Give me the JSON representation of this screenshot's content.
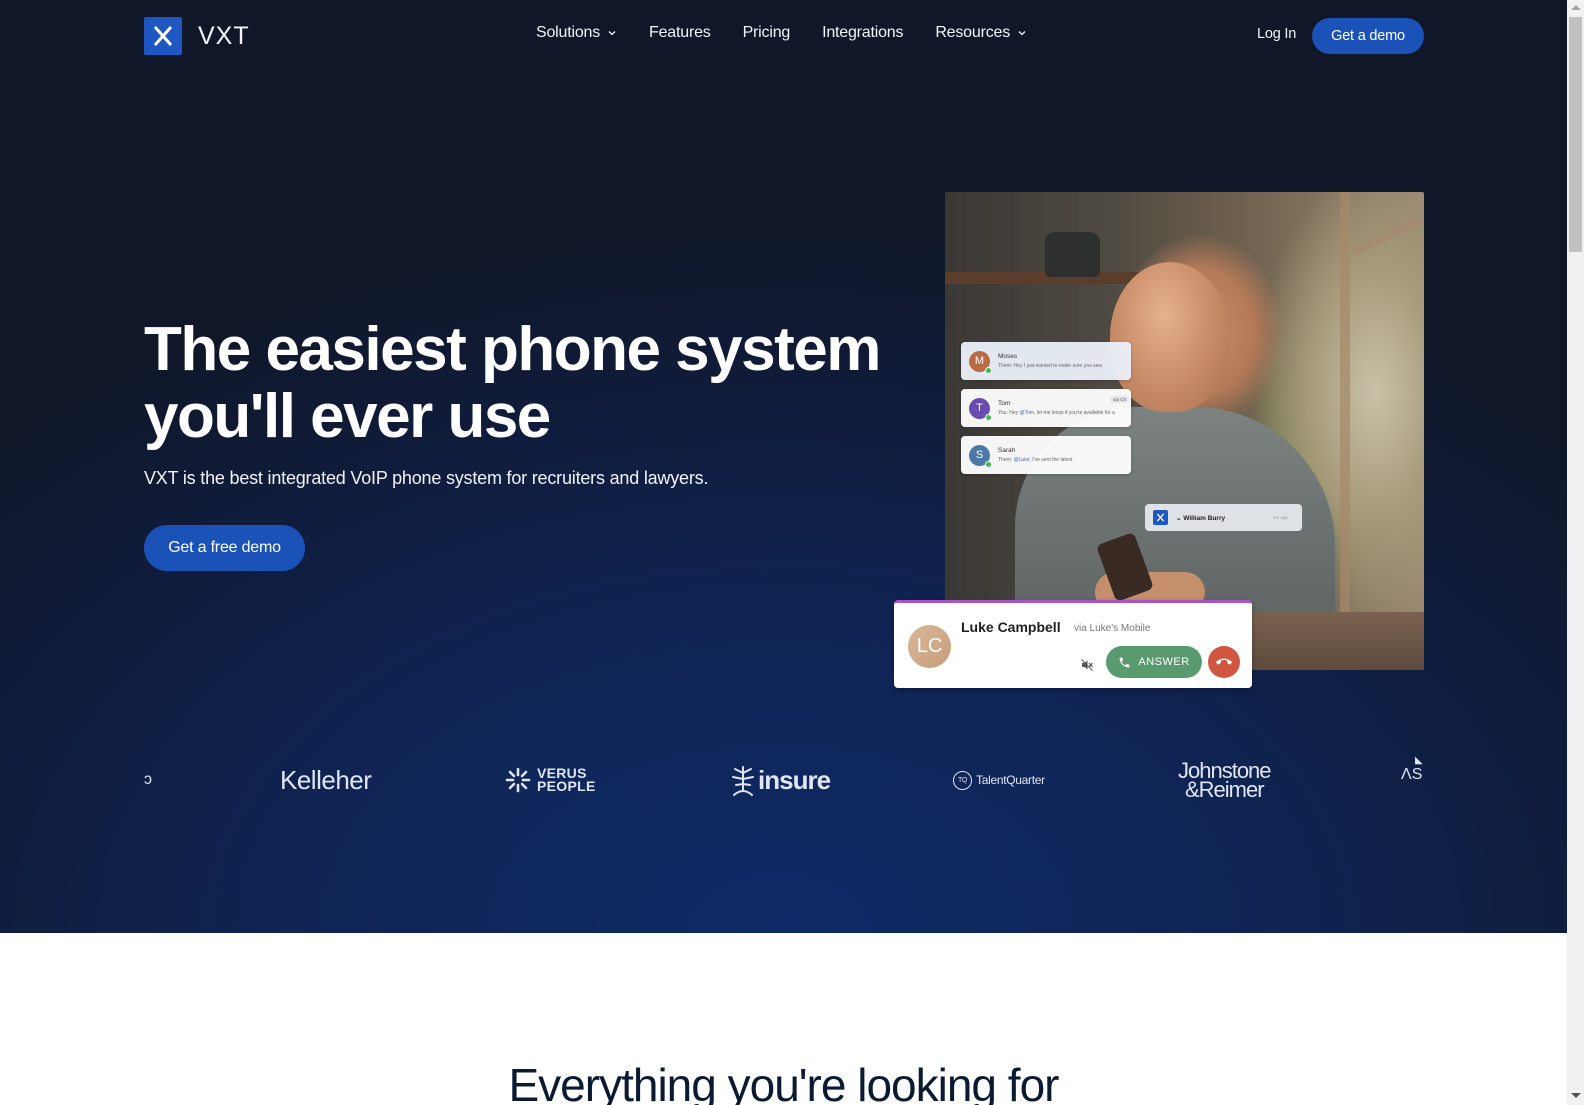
{
  "nav": {
    "brand": "VXT",
    "links": [
      {
        "label": "Solutions",
        "has_dropdown": true
      },
      {
        "label": "Features",
        "has_dropdown": false
      },
      {
        "label": "Pricing",
        "has_dropdown": false
      },
      {
        "label": "Integrations",
        "has_dropdown": false
      },
      {
        "label": "Resources",
        "has_dropdown": true
      }
    ],
    "login_label": "Log In",
    "cta_label": "Get a demo"
  },
  "hero": {
    "headline": "The easiest phone system you'll ever use",
    "subhead": "VXT is the best integrated VoIP phone system for recruiters and lawyers.",
    "cta_label": "Get a free demo",
    "chats": [
      {
        "initial": "M",
        "name": "Moses",
        "message": "Them: Hey I just wanted to make sure you saw",
        "avatar_color": "#b86b45",
        "tag": ""
      },
      {
        "initial": "T",
        "name": "Tom",
        "message_prefix": "You: Hey ",
        "mention": "@Tom",
        "message_suffix": ", let me know if you're available for a",
        "avatar_color": "#6a4cb0",
        "tag": "via Ch"
      },
      {
        "initial": "S",
        "name": "Sarah",
        "message_prefix": "Them: ",
        "mention": "@Luke",
        "message_suffix": ", I've sent the latest",
        "avatar_color": "#4a78a8",
        "tag": ""
      }
    ],
    "notification": {
      "name": "William Burry",
      "time": "1m ago"
    },
    "call": {
      "initials": "LC",
      "caller": "Luke Campbell",
      "via": "via Luke's Mobile",
      "answer_label": "ANSWER"
    }
  },
  "logos": {
    "partial_left": "ↄ",
    "items": [
      "Kelleher",
      "VERUS PEOPLE",
      "insure",
      "TalentQuarter",
      "Johnstone & Reimer",
      "AS"
    ],
    "verus_line1": "VERUS",
    "verus_line2": "PEOPLE",
    "insure_text": "insure",
    "talent_badge": "TQ",
    "talent_text": "TalentQuarter",
    "johnstone_line1": "Johnstone",
    "johnstone_line2": "&Reimer",
    "as_text": "ΛS"
  },
  "section": {
    "title": "Everything you're looking for"
  },
  "colors": {
    "brand_blue": "#1b52b8",
    "hero_bg": "#0f1f48",
    "answer_green": "#5a9a6f",
    "decline_red": "#d0563f",
    "call_card_accent": "#a855c7"
  }
}
